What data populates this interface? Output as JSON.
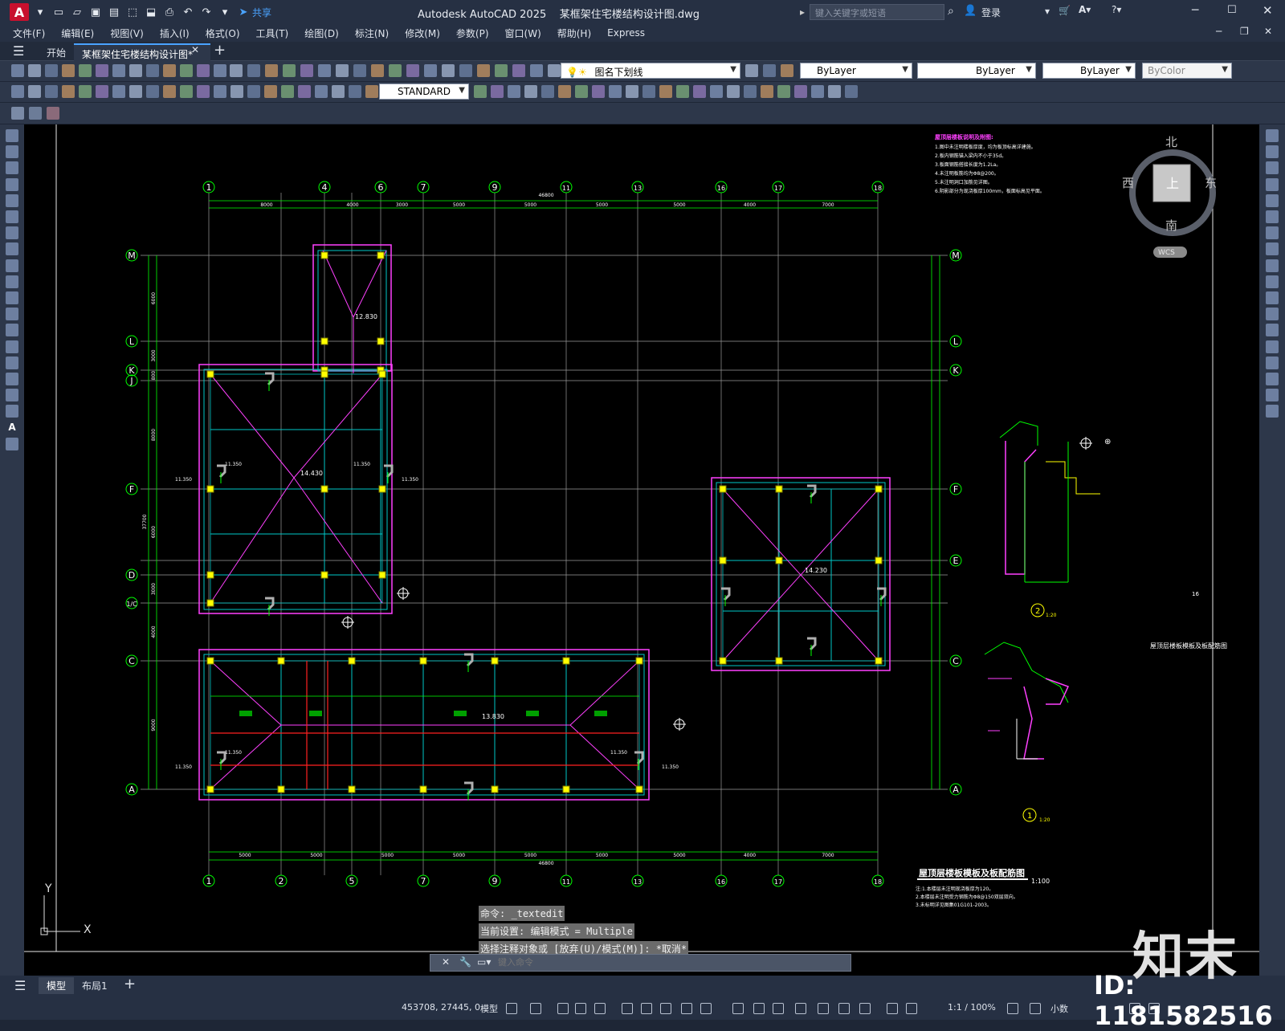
{
  "title": {
    "app": "Autodesk AutoCAD 2025",
    "file": "某框架住宅楼结构设计图.dwg"
  },
  "quick_access": {
    "share": "共享",
    "search_placeholder": "键入关键字或短语",
    "login": "登录"
  },
  "menu": [
    "文件(F)",
    "编辑(E)",
    "视图(V)",
    "插入(I)",
    "格式(O)",
    "工具(T)",
    "绘图(D)",
    "标注(N)",
    "修改(M)",
    "参数(P)",
    "窗口(W)",
    "帮助(H)",
    "Express"
  ],
  "tabs": {
    "start": "开始",
    "doc": "某框架住宅楼结构设计图*"
  },
  "properties": {
    "layer": "图名下划线",
    "color": "ByLayer",
    "linetype": "ByLayer",
    "lineweight": "ByLayer",
    "plotstyle": "ByColor"
  },
  "text_style": "STANDARD",
  "viewcube": {
    "north": "北",
    "south": "南",
    "east": "东",
    "west": "西",
    "top": "上",
    "wcs": "WCS"
  },
  "drawing": {
    "axes_top": [
      "1",
      "4",
      "6",
      "7",
      "9",
      "11",
      "13",
      "16",
      "17",
      "18"
    ],
    "axes_bottom": [
      "1",
      "2",
      "5",
      "7",
      "9",
      "11",
      "13",
      "16",
      "17",
      "18"
    ],
    "axes_left": [
      "M",
      "L",
      "K",
      "J",
      "F",
      "D",
      "1/C",
      "C",
      "A"
    ],
    "axes_right": [
      "M",
      "L",
      "K",
      "F",
      "E",
      "C",
      "A"
    ],
    "dims_top": [
      "8000",
      "4000",
      "3000",
      "5000",
      "5000",
      "5000",
      "5000",
      "4000",
      "7000"
    ],
    "total_top": "46800",
    "dims_bottom": [
      "5000",
      "5000",
      "5000",
      "5000",
      "5000",
      "5000",
      "5000",
      "4000",
      "7000"
    ],
    "total_bottom": "46800",
    "dims_left": [
      "6000",
      "3000",
      "800",
      "8000",
      "6000",
      "3000",
      "4000",
      "9000"
    ],
    "total_left": "37700",
    "elevations": [
      "12.830",
      "14.430",
      "14.230",
      "13.830"
    ],
    "level_labels": [
      "11.350",
      "11.350",
      "11.350",
      "11.350",
      "11.350",
      "11.350",
      "11.350",
      "11.350"
    ],
    "notes_title": "屋顶层楼板说明及附图:",
    "notes": [
      "1.图中未注明楼板厚度，均为板顶标高详建施。",
      "2.板内钢筋锚入梁内不小于35d。",
      "3.板面钢筋搭接长度为1.2La。",
      "4.未注明板筋均为Φ8@200。",
      "5.未注明洞口加筋见详图。",
      "6.阴影部分为现浇板厚100mm，板面标高见平面。"
    ],
    "plan_title": "屋顶层楼板模板及板配筋图",
    "plan_scale": "1:100",
    "plan_notes": [
      "注:1.本楼层未注明现浇板厚为120。",
      "2.本楼层未注明受力钢筋为Φ8@150双层双向。",
      "3.未标明详见图集01G101-2003。"
    ],
    "side_title": "屋顶层楼板模板及板配筋图",
    "detail_2": "2",
    "detail_2_scale": "1:20",
    "detail_1": "1",
    "detail_1_scale": "1:20",
    "detail_left_text": "16"
  },
  "command": [
    "命令: _textedit",
    "当前设置: 编辑模式 = Multiple",
    "选择注释对象或 [放弃(U)/模式(M)]: *取消*"
  ],
  "command_placeholder": "键入命令",
  "layout_tabs": [
    "模型",
    "布局1"
  ],
  "status": {
    "coords": "453708, 27445, 0",
    "mode": "模型",
    "scale": "1:1 / 100%",
    "units": "小数"
  },
  "watermark": {
    "id": "ID: 1181582516",
    "logo": "知末"
  }
}
